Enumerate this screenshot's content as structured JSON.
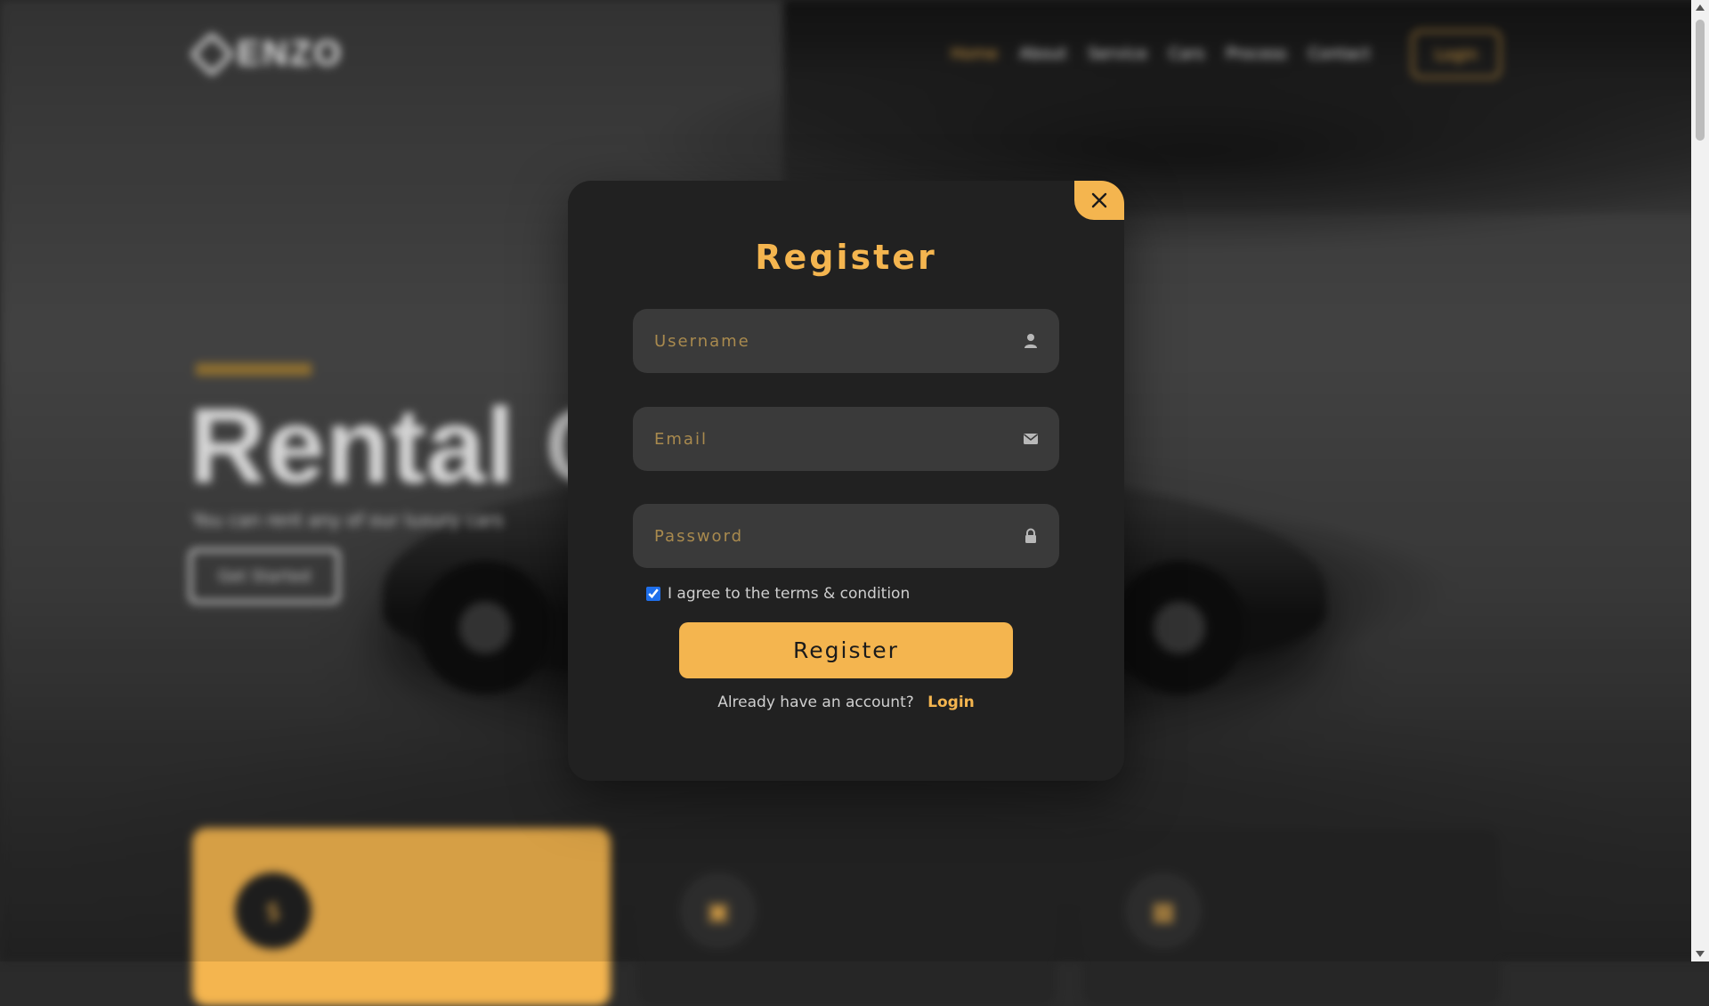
{
  "background": {
    "logo": "ENZO",
    "nav": [
      "Home",
      "About",
      "Service",
      "Cars",
      "Process",
      "Contact"
    ],
    "login_button": "Login",
    "hero_title": "Rental Car",
    "hero_subtitle": "You can rent any of our luxury cars",
    "hero_button": "Get Started"
  },
  "modal": {
    "title": "Register",
    "fields": {
      "username": {
        "placeholder": "Username",
        "icon": "user-icon"
      },
      "email": {
        "placeholder": "Email",
        "icon": "envelope-icon"
      },
      "password": {
        "placeholder": "Password",
        "icon": "lock-icon"
      }
    },
    "terms_label": "I agree to the terms & condition",
    "terms_checked": true,
    "submit_label": "Register",
    "have_account_text": "Already have an account?",
    "login_link": "Login",
    "close_icon": "close-icon"
  },
  "colors": {
    "accent": "#f4b54f",
    "modal_bg": "#212121",
    "field_bg": "#3a3a3a"
  }
}
